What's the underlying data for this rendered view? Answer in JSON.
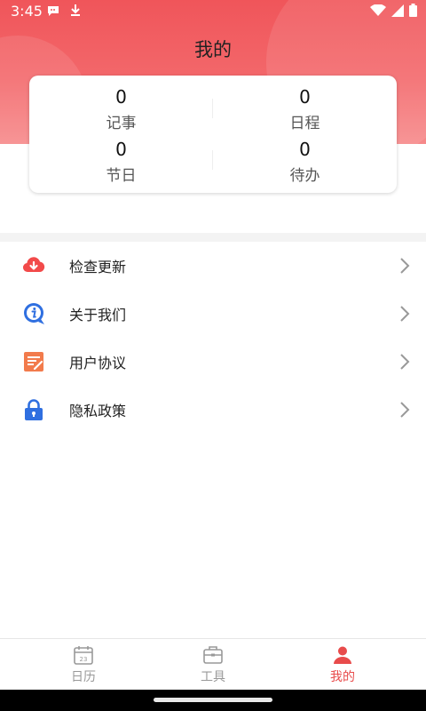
{
  "status_bar": {
    "time": "3:45",
    "icons": [
      "chat-notification-icon",
      "download-icon",
      "wifi-icon",
      "signal-icon",
      "battery-icon"
    ]
  },
  "header": {
    "title": "我的",
    "gradient_colors": [
      "#f0555a",
      "#f6898a"
    ]
  },
  "stats": {
    "notes": {
      "value": "0",
      "label": "记事"
    },
    "schedule": {
      "value": "0",
      "label": "日程"
    },
    "holidays": {
      "value": "0",
      "label": "节日"
    },
    "todo": {
      "value": "0",
      "label": "待办"
    }
  },
  "menu": {
    "items": [
      {
        "label": "检查更新",
        "icon": "cloud-download-icon",
        "icon_color": "#f24a4a"
      },
      {
        "label": "关于我们",
        "icon": "info-icon",
        "icon_color": "#2f6fe0"
      },
      {
        "label": "用户协议",
        "icon": "document-icon",
        "icon_color": "#f27b4c"
      },
      {
        "label": "隐私政策",
        "icon": "lock-icon",
        "icon_color": "#2f6fe0"
      }
    ]
  },
  "bottom_nav": {
    "tabs": [
      {
        "label": "日历",
        "icon": "calendar-icon",
        "active": false,
        "icon_text": "23"
      },
      {
        "label": "工具",
        "icon": "toolbox-icon",
        "active": false
      },
      {
        "label": "我的",
        "icon": "person-icon",
        "active": true
      }
    ],
    "active_color": "#e84b4b",
    "inactive_color": "#999999"
  }
}
